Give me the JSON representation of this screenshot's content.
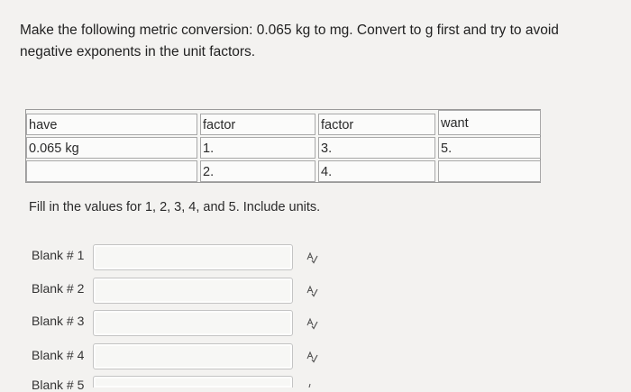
{
  "question": {
    "text": "Make the following metric conversion: 0.065 kg to mg. Convert to g first and try to avoid negative exponents in the unit factors."
  },
  "table": {
    "headers": {
      "have": "have",
      "factor1": "factor",
      "factor2": "factor",
      "want": "want"
    },
    "row1": {
      "have": "0.065 kg",
      "factor1": "1.",
      "factor2": "3.",
      "want": "5."
    },
    "row2": {
      "have": "",
      "factor1": "2.",
      "factor2": "4.",
      "want": ""
    }
  },
  "instructions": "Fill in the values for 1, 2, 3, 4, and 5. Include units.",
  "blanks": [
    {
      "label": "Blank # 1",
      "value": "",
      "icon": "spell-check-icon"
    },
    {
      "label": "Blank # 2",
      "value": "",
      "icon": "spell-check-icon"
    },
    {
      "label": "Blank # 3",
      "value": "",
      "icon": "spell-check-icon"
    },
    {
      "label": "Blank # 4",
      "value": "",
      "icon": "spell-check-icon"
    },
    {
      "label": "Blank # 5",
      "value": "",
      "icon": "spell-check-icon"
    }
  ]
}
